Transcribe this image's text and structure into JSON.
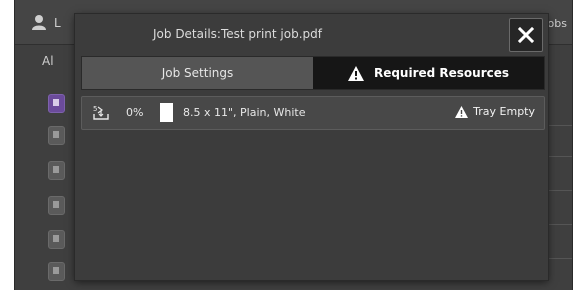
{
  "background": {
    "user_label": "L",
    "jobs_label": "Jobs",
    "all_tab": "Al",
    "user_icon": "user-icon",
    "list_icon": "document-icon",
    "menu_icon": "menu-icon"
  },
  "dialog": {
    "title": "Job Details:Test print job.pdf",
    "close_icon": "close-icon",
    "tabs": [
      {
        "label": "Job Settings",
        "selected": false
      },
      {
        "label": "Required Resources",
        "selected": true,
        "icon": "warning-icon"
      }
    ],
    "resources": [
      {
        "tray_icon": "tray-feed-icon",
        "percent": "0%",
        "paper": "8.5 x 11\", Plain, White",
        "status_icon": "warning-icon",
        "status": "Tray Empty"
      }
    ]
  },
  "colors": {
    "screen_bg": "#3f3f3f",
    "selected_tab": "#161616",
    "unselected_tab": "#555555"
  }
}
